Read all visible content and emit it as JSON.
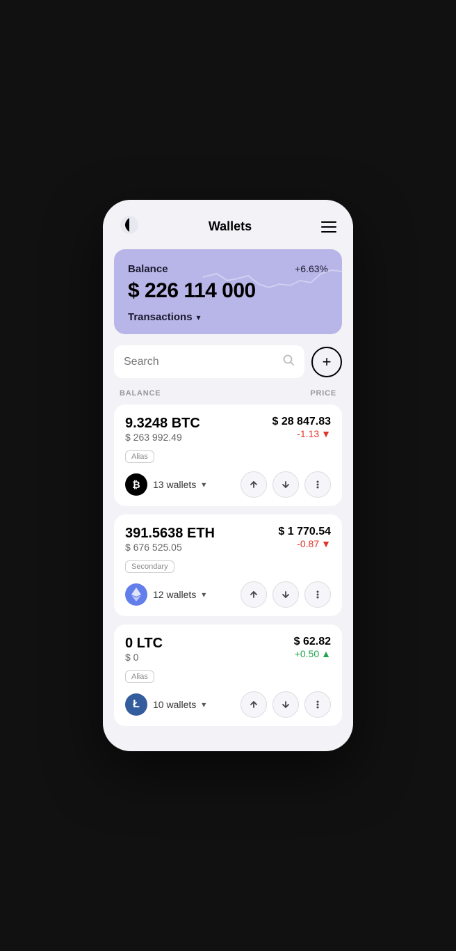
{
  "header": {
    "title": "Wallets",
    "logo_alt": "app-logo",
    "menu_alt": "menu"
  },
  "balance_card": {
    "label": "Balance",
    "amount": "$ 226 114 000",
    "change": "+6.63%",
    "transactions_label": "Transactions"
  },
  "search": {
    "placeholder": "Search"
  },
  "table_headers": {
    "balance": "BALANCE",
    "price": "PRICE"
  },
  "assets": [
    {
      "id": "btc",
      "amount": "9.3248 BTC",
      "usd_value": "$ 263 992.49",
      "price": "$ 28 847.83",
      "change": "-1.13",
      "change_dir": "neg",
      "alias": "Alias",
      "wallet_count": "13 wallets",
      "symbol": "₿"
    },
    {
      "id": "eth",
      "amount": "391.5638 ETH",
      "usd_value": "$ 676 525.05",
      "price": "$ 1 770.54",
      "change": "-0.87",
      "change_dir": "neg",
      "alias": "Secondary",
      "wallet_count": "12 wallets",
      "symbol": "⬡"
    },
    {
      "id": "ltc",
      "amount": "0 LTC",
      "usd_value": "$ 0",
      "price": "$ 62.82",
      "change": "+0.50",
      "change_dir": "pos",
      "alias": "Alias",
      "wallet_count": "10 wallets",
      "symbol": "Ł"
    }
  ]
}
